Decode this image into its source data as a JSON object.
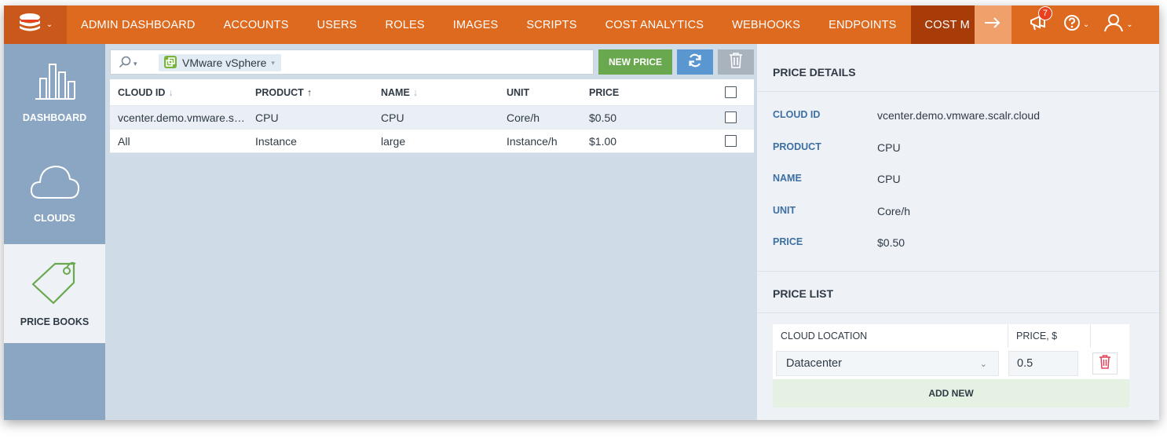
{
  "topnav": {
    "items": [
      "ADMIN DASHBOARD",
      "ACCOUNTS",
      "USERS",
      "ROLES",
      "IMAGES",
      "SCRIPTS",
      "COST ANALYTICS",
      "WEBHOOKS",
      "ENDPOINTS"
    ],
    "active_item": "COST M",
    "notification_count": "7",
    "icons": [
      "stack-logo-icon",
      "arrow-right-icon",
      "megaphone-icon",
      "help-icon",
      "user-icon"
    ]
  },
  "sidebar": {
    "items": [
      {
        "label": "DASHBOARD",
        "icon": "bar-chart-icon"
      },
      {
        "label": "CLOUDS",
        "icon": "cloud-icon"
      },
      {
        "label": "PRICE BOOKS",
        "icon": "price-tag-icon",
        "active": true
      }
    ]
  },
  "toolbar": {
    "filter_chip": "VMware vSphere",
    "new_price_label": "NEW PRICE"
  },
  "grid": {
    "columns": [
      "CLOUD ID",
      "PRODUCT",
      "NAME",
      "UNIT",
      "PRICE"
    ],
    "rows": [
      {
        "cloud_id": "vcenter.demo.vmware.scalr.cloud",
        "product": "CPU",
        "name": "CPU",
        "unit": "Core/h",
        "price": "$0.50"
      },
      {
        "cloud_id": "All",
        "product": "Instance",
        "name": "large",
        "unit": "Instance/h",
        "price": "$1.00"
      }
    ]
  },
  "details": {
    "title": "PRICE DETAILS",
    "fields": [
      {
        "key": "CLOUD ID",
        "value": "vcenter.demo.vmware.scalr.cloud"
      },
      {
        "key": "PRODUCT",
        "value": "CPU"
      },
      {
        "key": "NAME",
        "value": "CPU"
      },
      {
        "key": "UNIT",
        "value": "Core/h"
      },
      {
        "key": "PRICE",
        "value": "$0.50"
      }
    ],
    "price_list": {
      "title": "PRICE LIST",
      "col_location": "CLOUD LOCATION",
      "col_price": "PRICE, $",
      "location_value": "Datacenter",
      "price_value": "0.5",
      "add_new_label": "ADD NEW"
    }
  },
  "colors": {
    "topbar": "#dd6a1f",
    "topbar_active": "#a73c08",
    "sidebar": "#8aa6c3",
    "new_price_button": "#6aa84f",
    "refresh_button": "#5a96d0"
  }
}
